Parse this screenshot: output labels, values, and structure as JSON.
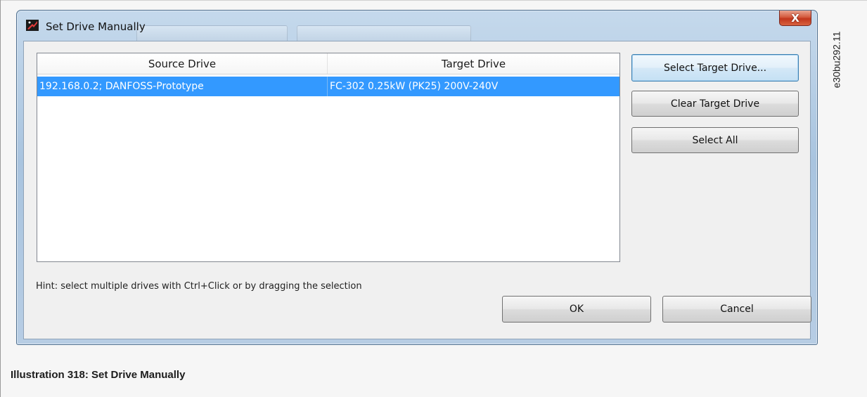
{
  "window": {
    "title": "Set Drive Manually",
    "close_glyph": "X"
  },
  "list": {
    "columns": [
      "Source Drive",
      "Target Drive"
    ],
    "rows": [
      {
        "source": "192.168.0.2; DANFOSS-Prototype",
        "target": "FC-302 0.25kW (PK25) 200V-240V",
        "selected": true
      }
    ]
  },
  "buttons": {
    "select_target": "Select Target Drive...",
    "clear_target": "Clear Target Drive",
    "select_all": "Select All",
    "ok": "OK",
    "cancel": "Cancel"
  },
  "hint": "Hint: select multiple drives with Ctrl+Click or by dragging the selection",
  "caption": "Illustration 318: Set Drive Manually",
  "side_code": "e30bu292.11",
  "colors": {
    "selection": "#3399ff",
    "close_button": "#c2361c",
    "focused_button_border": "#3c7fb1"
  }
}
